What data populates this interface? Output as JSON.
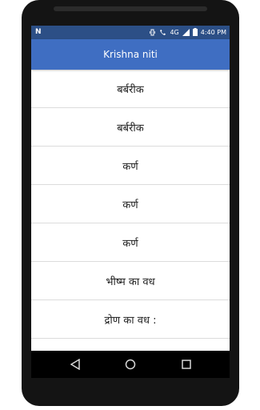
{
  "status_bar": {
    "app_icon": "N",
    "network_label": "4G",
    "time": "4:40",
    "period": "PM",
    "icons": [
      "vibrate-icon",
      "wifi-calling-icon",
      "signal-icon",
      "battery-icon"
    ]
  },
  "app_bar": {
    "title": "Krishna niti"
  },
  "list": {
    "items": [
      {
        "label": "बर्बरीक"
      },
      {
        "label": "बर्बरीक"
      },
      {
        "label": "कर्ण"
      },
      {
        "label": "कर्ण"
      },
      {
        "label": "कर्ण"
      },
      {
        "label": "भीष्म का वध"
      },
      {
        "label": "द्रोण का वध :"
      }
    ]
  },
  "nav_bar": {
    "icons": [
      "back-icon",
      "home-icon",
      "recents-icon"
    ]
  },
  "colors": {
    "status_bar": "#2c4f86",
    "app_bar": "#3f6ec2",
    "phone_frame": "#141414",
    "divider": "#dcdcdc"
  }
}
